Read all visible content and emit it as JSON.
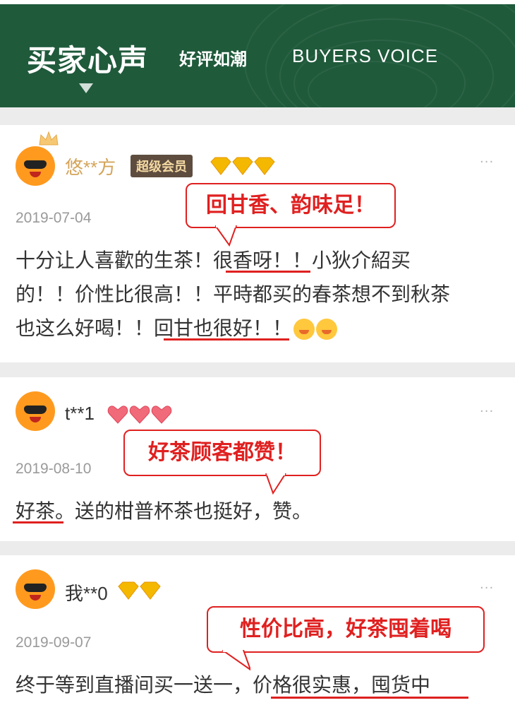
{
  "banner": {
    "title": "买家心声",
    "subtitle": "好评如潮",
    "english": "BUYERS VOICE"
  },
  "reviews": [
    {
      "username": "悠**方",
      "badge": "超级会员",
      "level_icons": [
        "diamond-icon",
        "diamond-icon",
        "diamond-icon"
      ],
      "more": "···",
      "date": "2019-07-04",
      "callout": "回甘香、韵味足！",
      "text": [
        "十分让人喜歡的生茶！很香呀！！小狄介紹买",
        "的！！价性比很高！！平時都买的春茶想不到秋茶",
        "也这么好喝！！回甘也很好！！"
      ]
    },
    {
      "username": "t**1",
      "level_icons": [
        "heart-icon",
        "heart-icon",
        "heart-icon"
      ],
      "more": "···",
      "date": "2019-08-10",
      "callout": "好茶顾客都赞！",
      "text": [
        "好茶。送的柑普杯茶也挺好，赞。"
      ]
    },
    {
      "username": "我**0",
      "level_icons": [
        "diamond-icon",
        "diamond-icon"
      ],
      "more": "···",
      "date": "2019-09-07",
      "callout": "性价比高，好茶囤着喝",
      "text": [
        "终于等到直播间买一送一，价格很实惠，囤货中"
      ]
    }
  ],
  "colors": {
    "banner": "#1f5a3b",
    "accent_red": "#e02020",
    "diamond": "#f5b800",
    "heart": "#f06a7a"
  }
}
